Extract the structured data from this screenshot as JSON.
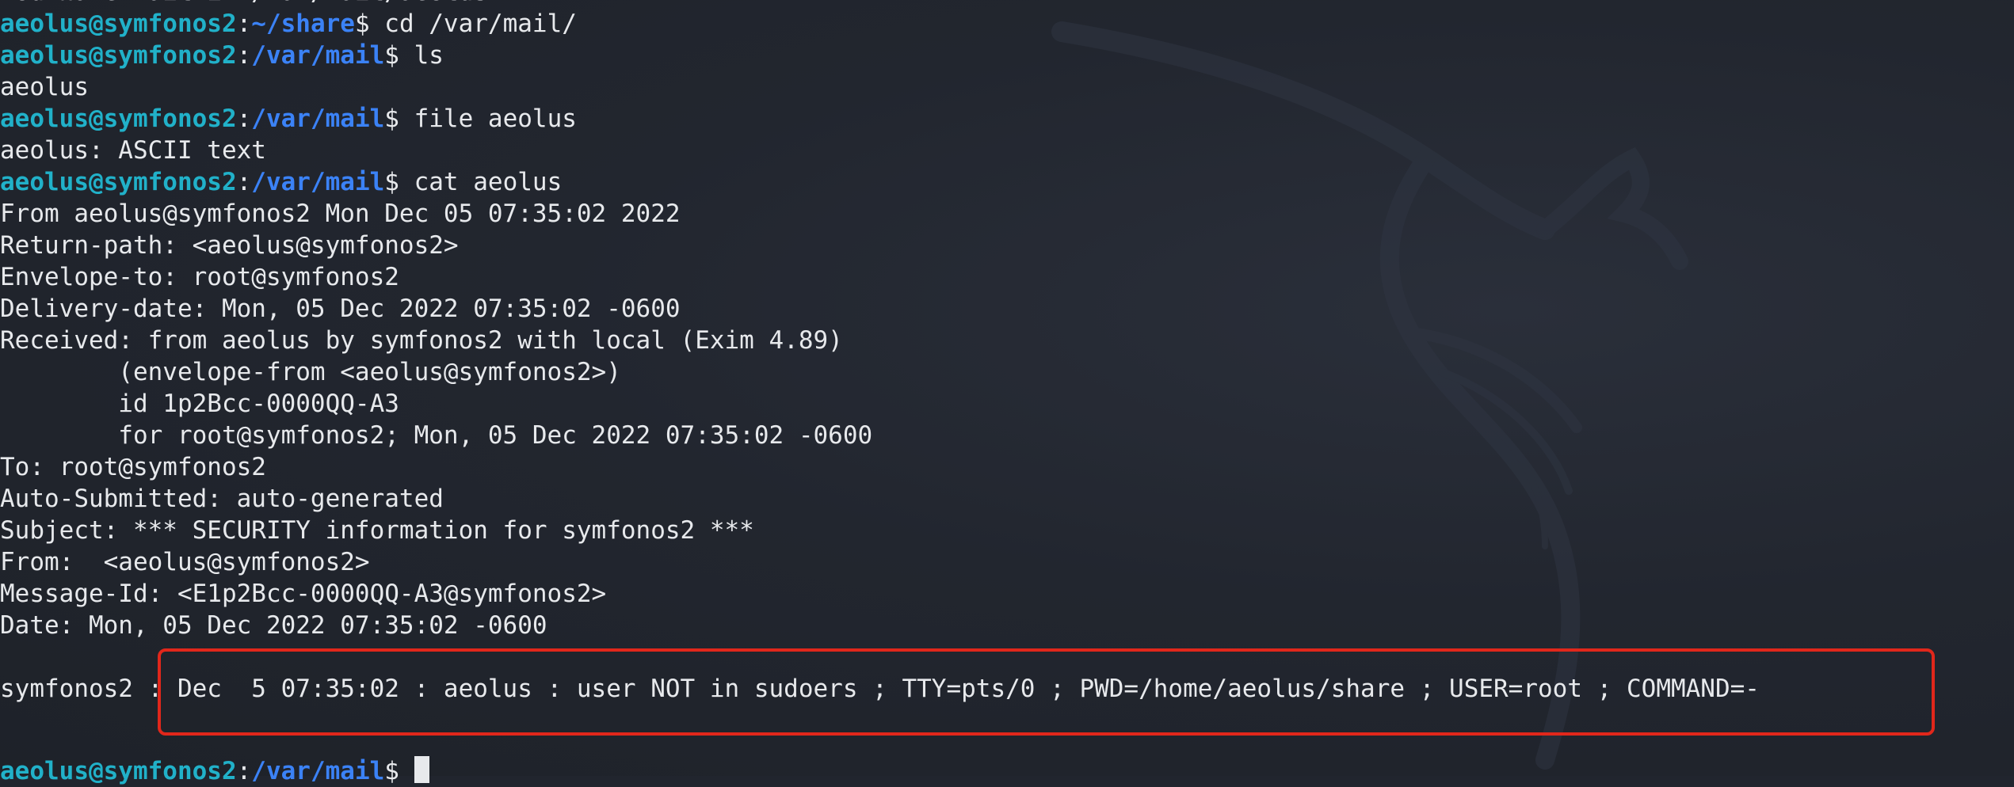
{
  "colors": {
    "background": "#21252e",
    "prompt_user": "#21b1c9",
    "prompt_path": "#3b82f6",
    "text": "#e7e9ec",
    "highlight_border": "#e1271b"
  },
  "terminal": {
    "top_partial": "You have mail in /var/mail/aeolus",
    "prompt_user": "aeolus@symfonos2",
    "cmd1_path": "~/share",
    "cmd1": "cd /var/mail/",
    "cmd2_path": "/var/mail",
    "cmd2": "ls",
    "out_ls": "aeolus",
    "cmd3_path": "/var/mail",
    "cmd3": "file aeolus",
    "out_file": "aeolus: ASCII text",
    "cmd4_path": "/var/mail",
    "cmd4": "cat aeolus",
    "mail_lines": [
      "From aeolus@symfonos2 Mon Dec 05 07:35:02 2022",
      "Return-path: <aeolus@symfonos2>",
      "Envelope-to: root@symfonos2",
      "Delivery-date: Mon, 05 Dec 2022 07:35:02 -0600",
      "Received: from aeolus by symfonos2 with local (Exim 4.89)",
      "        (envelope-from <aeolus@symfonos2>)",
      "        id 1p2Bcc-0000QQ-A3",
      "        for root@symfonos2; Mon, 05 Dec 2022 07:35:02 -0600",
      "To: root@symfonos2",
      "Auto-Submitted: auto-generated",
      "Subject: *** SECURITY information for symfonos2 ***",
      "From:  <aeolus@symfonos2>",
      "Message-Id: <E1p2Bcc-0000QQ-A3@symfonos2>",
      "Date: Mon, 05 Dec 2022 07:35:02 -0600"
    ],
    "security_line": "symfonos2 : Dec  5 07:35:02 : aeolus : user NOT in sudoers ; TTY=pts/0 ; PWD=/home/aeolus/share ; USER=root ; COMMAND=-",
    "final_path": "/var/mail"
  }
}
